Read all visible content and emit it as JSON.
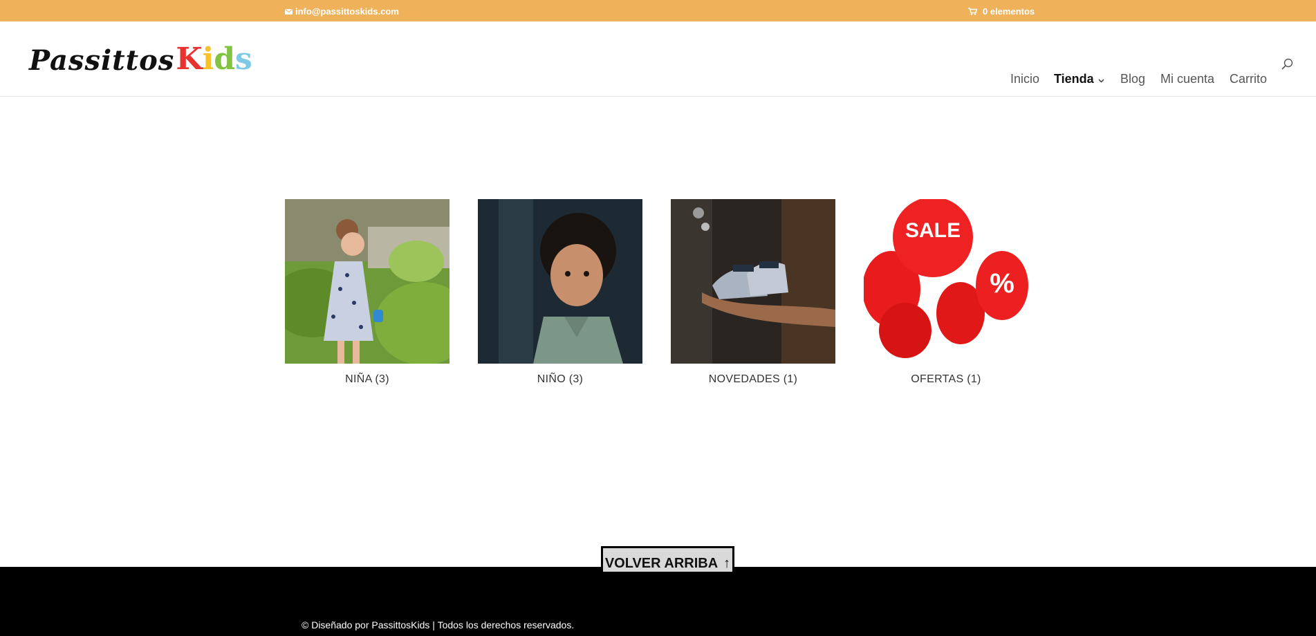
{
  "topbar": {
    "email": "info@passittoskids.com",
    "cart": "0 elementos",
    "background": "#efb25a"
  },
  "logo": {
    "part1": "Passittos",
    "kids_letters": [
      "K",
      "i",
      "d",
      "s"
    ]
  },
  "nav": {
    "items": [
      {
        "label": "Inicio"
      },
      {
        "label": "Tienda",
        "active": true,
        "has_dropdown": true
      },
      {
        "label": "Blog"
      },
      {
        "label": "Mi cuenta"
      },
      {
        "label": "Carrito"
      }
    ],
    "search_icon": "search-icon"
  },
  "categories": [
    {
      "name": "NIÑA",
      "count": "(3)"
    },
    {
      "name": "NIÑO",
      "count": "(3)"
    },
    {
      "name": "NOVEDADES",
      "count": "(1)"
    },
    {
      "name": "OFERTAS",
      "count": "(1)"
    }
  ],
  "back_to_top": {
    "label": "VOLVER ARRIBA",
    "icon": "↑"
  },
  "footer": {
    "copyright": "© Diseñado por PassittosKids | Todos los derechos reservados."
  }
}
